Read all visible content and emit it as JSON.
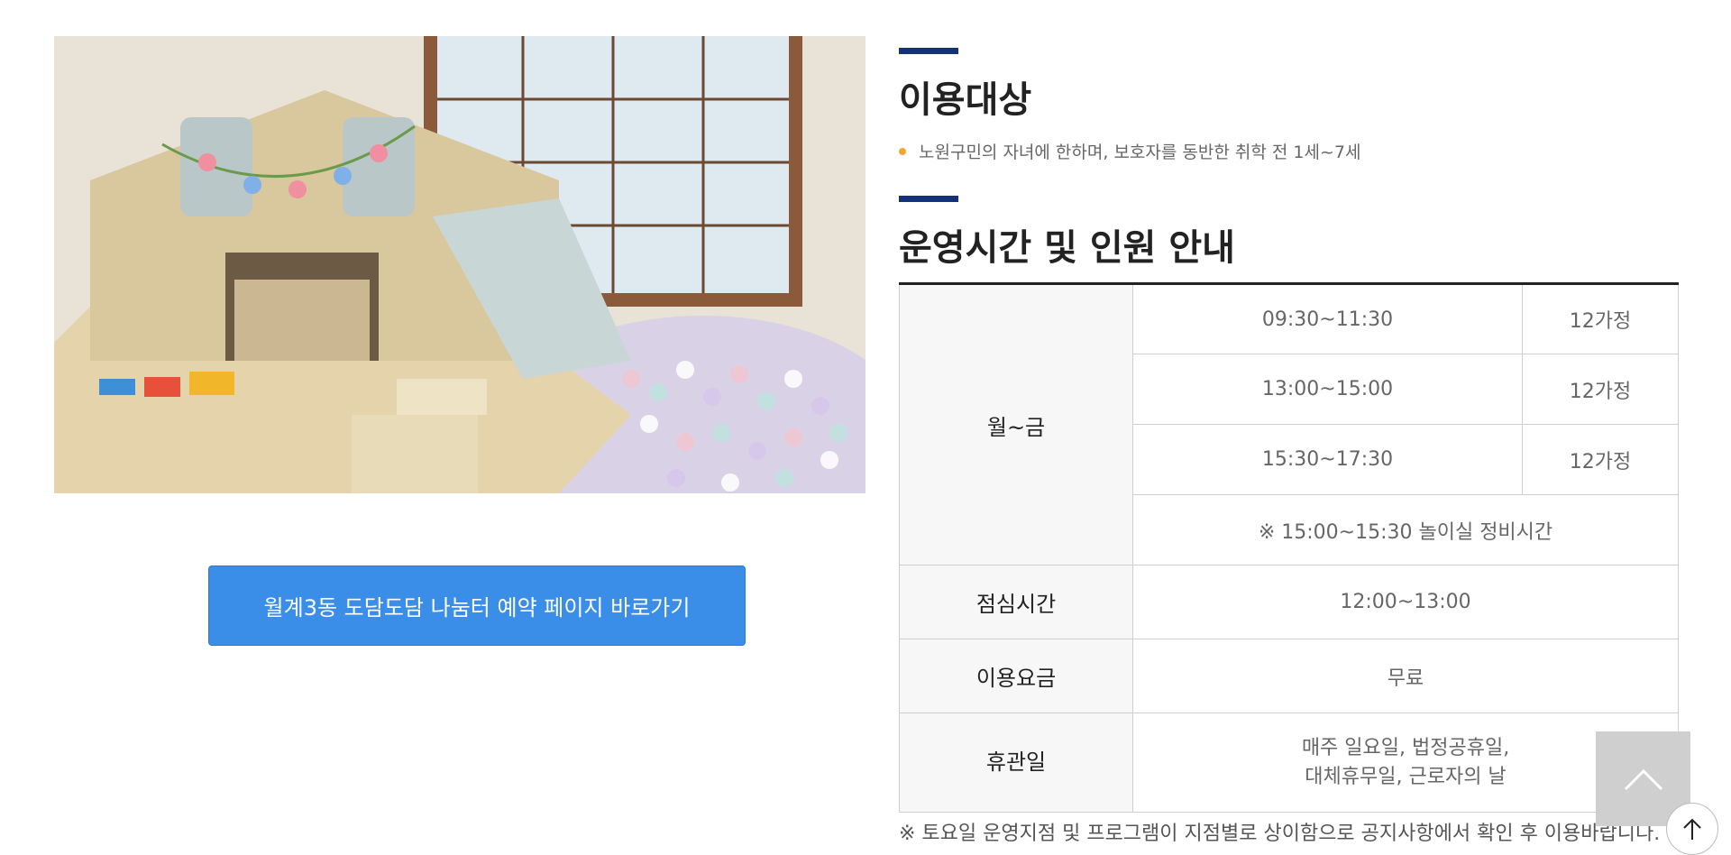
{
  "image": {
    "alt_icon": "playroom-photo"
  },
  "reserve_button": {
    "label": "월계3동 도담도담 나눔터 예약 페이지 바로가기"
  },
  "target": {
    "title": "이용대상",
    "bullet": "노원구민의 자녀에 한하며, 보호자를 동반한 취학 전 1세~7세"
  },
  "hours": {
    "title": "운영시간 및 인원 안내",
    "weekday_label": "월~금",
    "slots": [
      {
        "time": "09:30~11:30",
        "capacity": "12가정"
      },
      {
        "time": "13:00~15:00",
        "capacity": "12가정"
      },
      {
        "time": "15:30~17:30",
        "capacity": "12가정"
      }
    ],
    "maintenance_note": "※ 15:00~15:30 놀이실 정비시간",
    "lunch_label": "점심시간",
    "lunch_value": "12:00~13:00",
    "fee_label": "이용요금",
    "fee_value": "무료",
    "closed_label": "휴관일",
    "closed_line1": "매주 일요일, 법정공휴일,",
    "closed_line2": "대체휴무일, 근로자의 날",
    "footnote": "※ 토요일 운영지점 및 프로그램이 지점별로 상이함으로 공지사항에서 확인 후 이용바랍니다."
  },
  "colors": {
    "accent_bar": "#13327a",
    "button": "#3b8ee8",
    "bullet": "#f0a830"
  },
  "icons": {
    "scroll_top": "chevron-up-icon",
    "round_top": "arrow-up-icon"
  }
}
